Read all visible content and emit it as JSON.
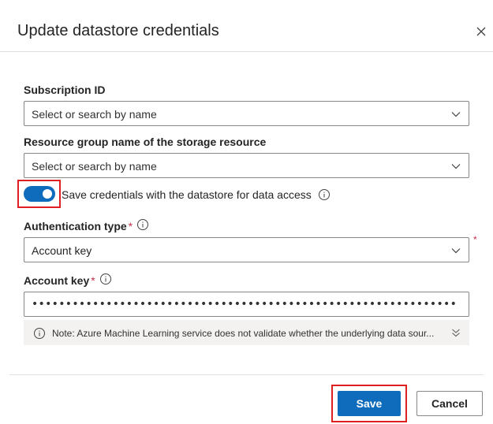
{
  "dialog": {
    "title": "Update datastore credentials",
    "close_icon": "close-icon"
  },
  "subscription": {
    "label": "Subscription ID",
    "placeholder": "Select or search by name"
  },
  "resource_group": {
    "label": "Resource group name of the storage resource",
    "placeholder": "Select or search by name"
  },
  "save_credentials": {
    "label": "Save credentials with the datastore for data access",
    "enabled": true
  },
  "authentication_type": {
    "label": "Authentication type",
    "required_marker": "*",
    "value": "Account key"
  },
  "account_key": {
    "label": "Account key",
    "required_marker": "*",
    "value": "••••••••••••••••••••••••••••••••••••••••••••••••••••••••••••••••••••••••••••••"
  },
  "note": {
    "text": "Note: Azure Machine Learning service does not validate whether the underlying data sour..."
  },
  "footer": {
    "save_label": "Save",
    "cancel_label": "Cancel"
  },
  "colors": {
    "accent": "#0f6cbd",
    "required": "#c4314b",
    "highlight": "#e02020"
  }
}
